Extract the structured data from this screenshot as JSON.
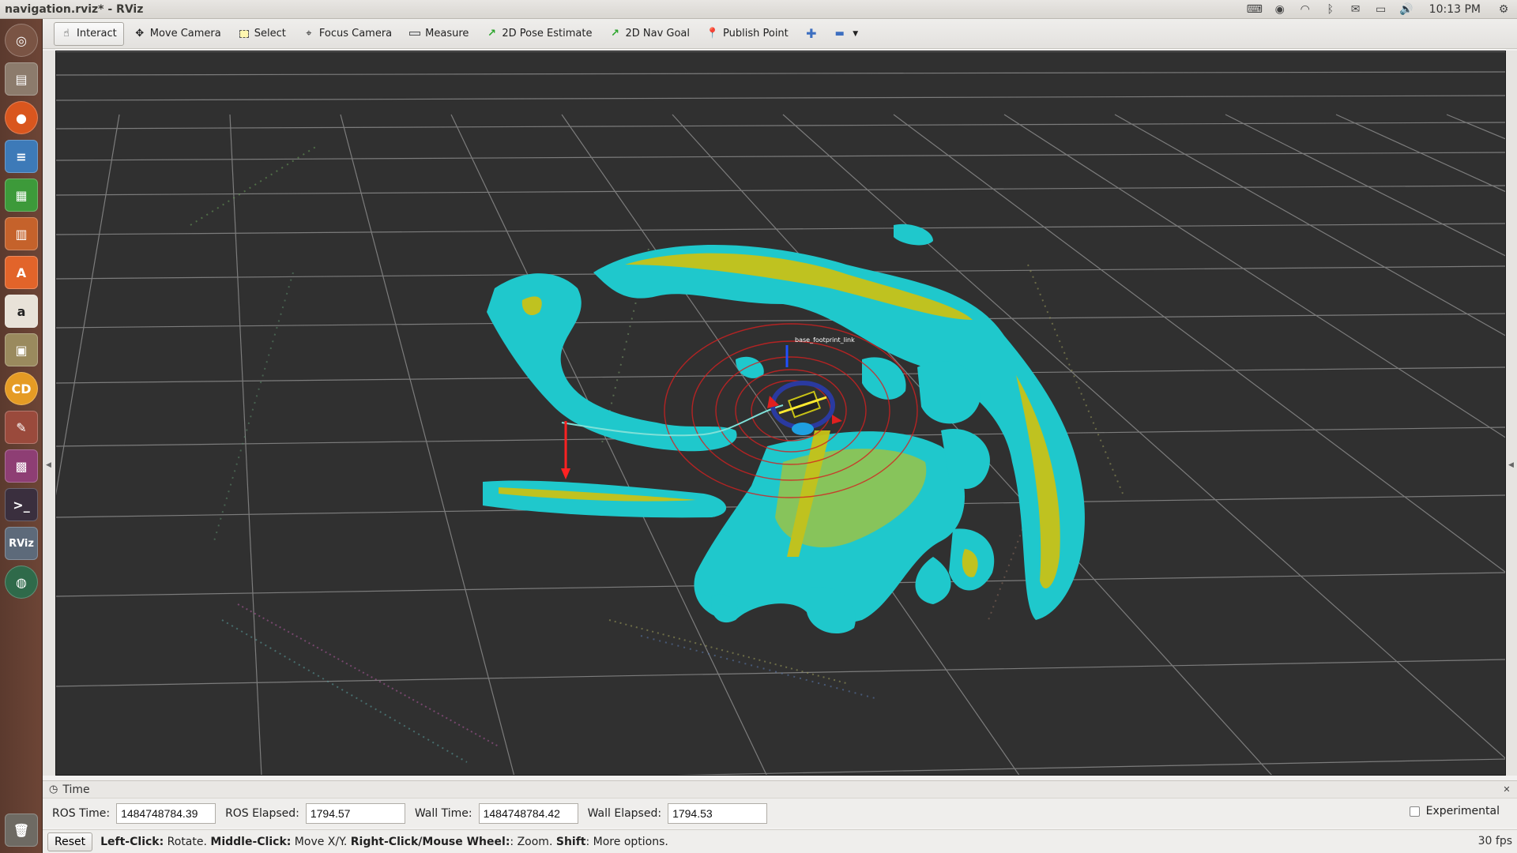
{
  "window": {
    "title": "navigation.rviz* - RViz"
  },
  "tray": {
    "clock": "10:13 PM"
  },
  "toolbar": {
    "tools": [
      {
        "label": "Interact",
        "icon": "hand-pointer-icon",
        "active": true
      },
      {
        "label": "Move Camera",
        "icon": "move-arrows-icon"
      },
      {
        "label": "Select",
        "icon": "select-rectangle-icon"
      },
      {
        "label": "Focus Camera",
        "icon": "focus-crosshair-icon"
      },
      {
        "label": "Measure",
        "icon": "ruler-icon"
      },
      {
        "label": "2D Pose Estimate",
        "icon": "green-arrow-icon"
      },
      {
        "label": "2D Nav Goal",
        "icon": "green-arrow-icon"
      },
      {
        "label": "Publish Point",
        "icon": "map-pin-icon"
      }
    ]
  },
  "view": {
    "robot_label": "base_footprint_link"
  },
  "time_panel": {
    "title": "Time",
    "ros_time_label": "ROS Time:",
    "ros_time": "1484748784.39",
    "ros_elapsed_label": "ROS Elapsed:",
    "ros_elapsed": "1794.57",
    "wall_time_label": "Wall Time:",
    "wall_time": "1484748784.42",
    "wall_elapsed_label": "Wall Elapsed:",
    "wall_elapsed": "1794.53",
    "experimental_label": "Experimental"
  },
  "status_bar": {
    "reset_label": "Reset",
    "left_click": "Left-Click:",
    "left_click_action": " Rotate. ",
    "middle_click": "Middle-Click:",
    "middle_click_action": " Move X/Y. ",
    "right_click": "Right-Click/Mouse Wheel:",
    "right_click_action": ": Zoom. ",
    "shift": "Shift",
    "shift_action": ": More options.",
    "fps": "30 fps"
  },
  "colors": {
    "costmap_inflation": "#1fc8cc",
    "costmap_obstacle": "#c8c216",
    "grid": "#8a8a8a",
    "background": "#303030",
    "path": "#7fe0d8",
    "axis": "#ff2222"
  }
}
